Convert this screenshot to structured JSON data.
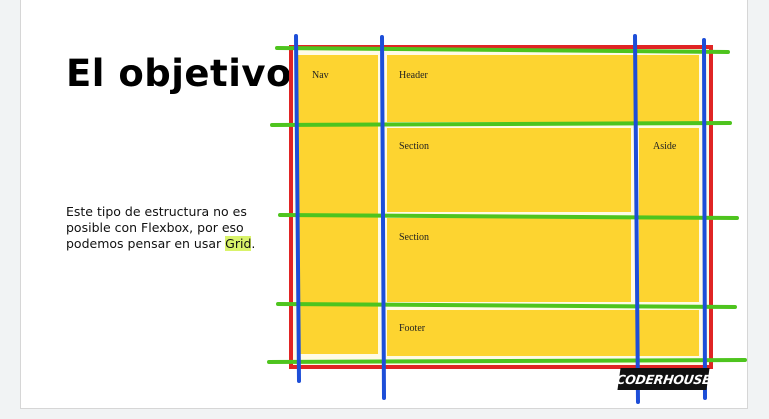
{
  "slide": {
    "title": "El objetivo",
    "description": {
      "text_before": "Este tipo de estructura no es posible con Flexbox, por eso podemos pensar en usar ",
      "highlight": "Grid",
      "text_after": "."
    }
  },
  "grid_diagram": {
    "cells": {
      "nav": "Nav",
      "header": "Header",
      "section_1": "Section",
      "aside": "Aside",
      "section_2": "Section",
      "footer": "Footer"
    },
    "colors": {
      "cell_fill": "#fdd430",
      "container_border": "#e02424",
      "column_lines": "#1d4ed8",
      "row_lines": "#4ec41e"
    }
  },
  "logo": {
    "text": "CODERHOUSE"
  }
}
